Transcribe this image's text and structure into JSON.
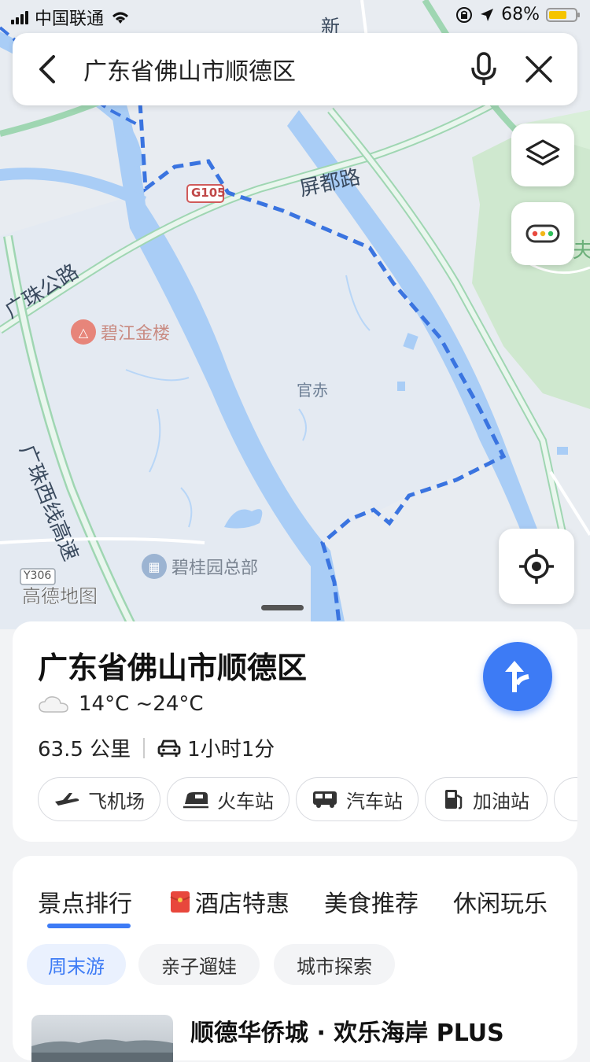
{
  "status": {
    "carrier": "中国联通",
    "battery_pct": "68%",
    "battery_level": 0.68
  },
  "search": {
    "query": "广东省佛山市顺德区"
  },
  "map": {
    "road_labels": [
      "屏都路",
      "广珠公路",
      "广珠西线高速"
    ],
    "highway_shield": "G105",
    "county_shield": "Y306",
    "area_label": "官赤",
    "poi_1": "碧江金楼",
    "poi_2": "碧桂园总部",
    "brand": "高德地图",
    "edge_text": [
      "新",
      "夫"
    ]
  },
  "place": {
    "title": "广东省佛山市顺德区",
    "weather": "14°C ~24°C",
    "distance": "63.5 公里",
    "drive_time": "1小时1分",
    "nearby": [
      {
        "label": "飞机场",
        "icon": "plane-icon"
      },
      {
        "label": "火车站",
        "icon": "train-icon"
      },
      {
        "label": "汽车站",
        "icon": "bus-icon"
      },
      {
        "label": "加油站",
        "icon": "fuel-icon"
      }
    ]
  },
  "discover": {
    "tabs": [
      "景点排行",
      "酒店特惠",
      "美食推荐",
      "休闲玩乐"
    ],
    "active_tab": "景点排行",
    "filters": [
      "周末游",
      "亲子遛娃",
      "城市探索"
    ],
    "active_filter": "周末游",
    "first_result": "顺德华侨城 · 欢乐海岸 PLUS"
  },
  "colors": {
    "accent": "#3d7bf5",
    "water": "#a9cdf6",
    "boundary": "#3a74e0",
    "park": "#cfe8cf"
  }
}
